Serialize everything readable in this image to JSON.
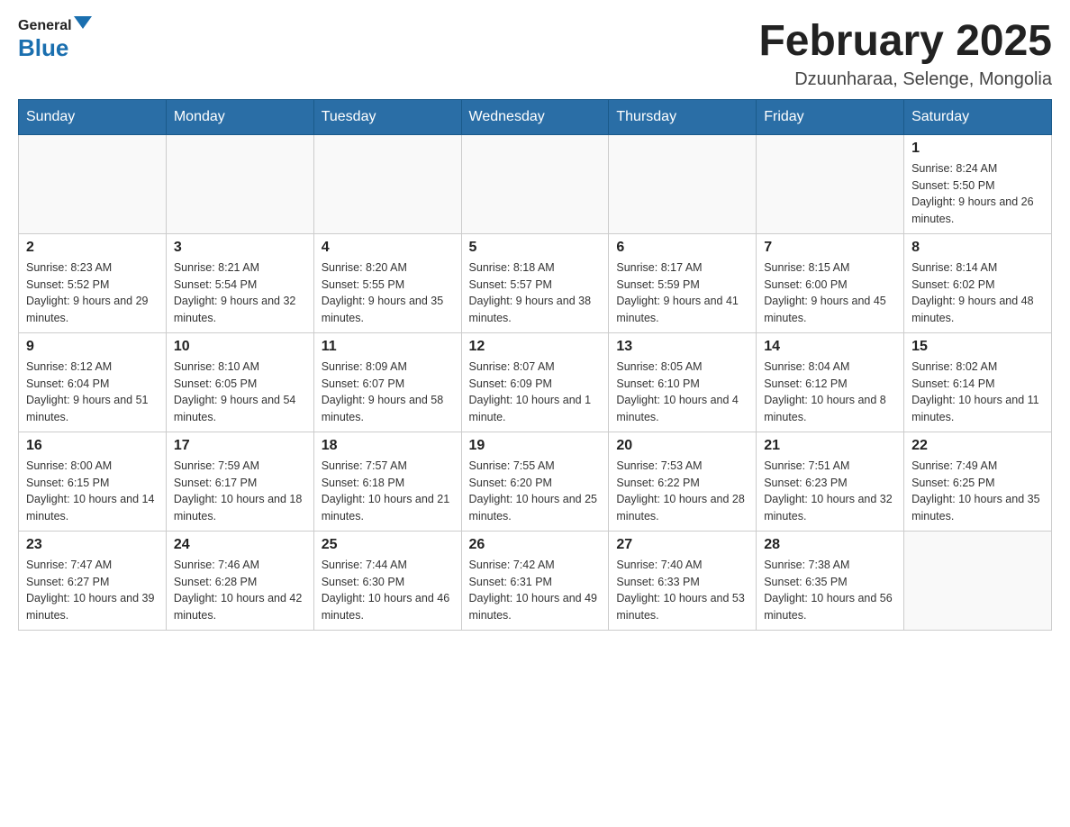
{
  "header": {
    "logo_general": "General",
    "logo_blue": "Blue",
    "month_title": "February 2025",
    "location": "Dzuunharaa, Selenge, Mongolia"
  },
  "weekdays": [
    "Sunday",
    "Monday",
    "Tuesday",
    "Wednesday",
    "Thursday",
    "Friday",
    "Saturday"
  ],
  "weeks": [
    [
      {
        "day": "",
        "info": ""
      },
      {
        "day": "",
        "info": ""
      },
      {
        "day": "",
        "info": ""
      },
      {
        "day": "",
        "info": ""
      },
      {
        "day": "",
        "info": ""
      },
      {
        "day": "",
        "info": ""
      },
      {
        "day": "1",
        "info": "Sunrise: 8:24 AM\nSunset: 5:50 PM\nDaylight: 9 hours and 26 minutes."
      }
    ],
    [
      {
        "day": "2",
        "info": "Sunrise: 8:23 AM\nSunset: 5:52 PM\nDaylight: 9 hours and 29 minutes."
      },
      {
        "day": "3",
        "info": "Sunrise: 8:21 AM\nSunset: 5:54 PM\nDaylight: 9 hours and 32 minutes."
      },
      {
        "day": "4",
        "info": "Sunrise: 8:20 AM\nSunset: 5:55 PM\nDaylight: 9 hours and 35 minutes."
      },
      {
        "day": "5",
        "info": "Sunrise: 8:18 AM\nSunset: 5:57 PM\nDaylight: 9 hours and 38 minutes."
      },
      {
        "day": "6",
        "info": "Sunrise: 8:17 AM\nSunset: 5:59 PM\nDaylight: 9 hours and 41 minutes."
      },
      {
        "day": "7",
        "info": "Sunrise: 8:15 AM\nSunset: 6:00 PM\nDaylight: 9 hours and 45 minutes."
      },
      {
        "day": "8",
        "info": "Sunrise: 8:14 AM\nSunset: 6:02 PM\nDaylight: 9 hours and 48 minutes."
      }
    ],
    [
      {
        "day": "9",
        "info": "Sunrise: 8:12 AM\nSunset: 6:04 PM\nDaylight: 9 hours and 51 minutes."
      },
      {
        "day": "10",
        "info": "Sunrise: 8:10 AM\nSunset: 6:05 PM\nDaylight: 9 hours and 54 minutes."
      },
      {
        "day": "11",
        "info": "Sunrise: 8:09 AM\nSunset: 6:07 PM\nDaylight: 9 hours and 58 minutes."
      },
      {
        "day": "12",
        "info": "Sunrise: 8:07 AM\nSunset: 6:09 PM\nDaylight: 10 hours and 1 minute."
      },
      {
        "day": "13",
        "info": "Sunrise: 8:05 AM\nSunset: 6:10 PM\nDaylight: 10 hours and 4 minutes."
      },
      {
        "day": "14",
        "info": "Sunrise: 8:04 AM\nSunset: 6:12 PM\nDaylight: 10 hours and 8 minutes."
      },
      {
        "day": "15",
        "info": "Sunrise: 8:02 AM\nSunset: 6:14 PM\nDaylight: 10 hours and 11 minutes."
      }
    ],
    [
      {
        "day": "16",
        "info": "Sunrise: 8:00 AM\nSunset: 6:15 PM\nDaylight: 10 hours and 14 minutes."
      },
      {
        "day": "17",
        "info": "Sunrise: 7:59 AM\nSunset: 6:17 PM\nDaylight: 10 hours and 18 minutes."
      },
      {
        "day": "18",
        "info": "Sunrise: 7:57 AM\nSunset: 6:18 PM\nDaylight: 10 hours and 21 minutes."
      },
      {
        "day": "19",
        "info": "Sunrise: 7:55 AM\nSunset: 6:20 PM\nDaylight: 10 hours and 25 minutes."
      },
      {
        "day": "20",
        "info": "Sunrise: 7:53 AM\nSunset: 6:22 PM\nDaylight: 10 hours and 28 minutes."
      },
      {
        "day": "21",
        "info": "Sunrise: 7:51 AM\nSunset: 6:23 PM\nDaylight: 10 hours and 32 minutes."
      },
      {
        "day": "22",
        "info": "Sunrise: 7:49 AM\nSunset: 6:25 PM\nDaylight: 10 hours and 35 minutes."
      }
    ],
    [
      {
        "day": "23",
        "info": "Sunrise: 7:47 AM\nSunset: 6:27 PM\nDaylight: 10 hours and 39 minutes."
      },
      {
        "day": "24",
        "info": "Sunrise: 7:46 AM\nSunset: 6:28 PM\nDaylight: 10 hours and 42 minutes."
      },
      {
        "day": "25",
        "info": "Sunrise: 7:44 AM\nSunset: 6:30 PM\nDaylight: 10 hours and 46 minutes."
      },
      {
        "day": "26",
        "info": "Sunrise: 7:42 AM\nSunset: 6:31 PM\nDaylight: 10 hours and 49 minutes."
      },
      {
        "day": "27",
        "info": "Sunrise: 7:40 AM\nSunset: 6:33 PM\nDaylight: 10 hours and 53 minutes."
      },
      {
        "day": "28",
        "info": "Sunrise: 7:38 AM\nSunset: 6:35 PM\nDaylight: 10 hours and 56 minutes."
      },
      {
        "day": "",
        "info": ""
      }
    ]
  ]
}
